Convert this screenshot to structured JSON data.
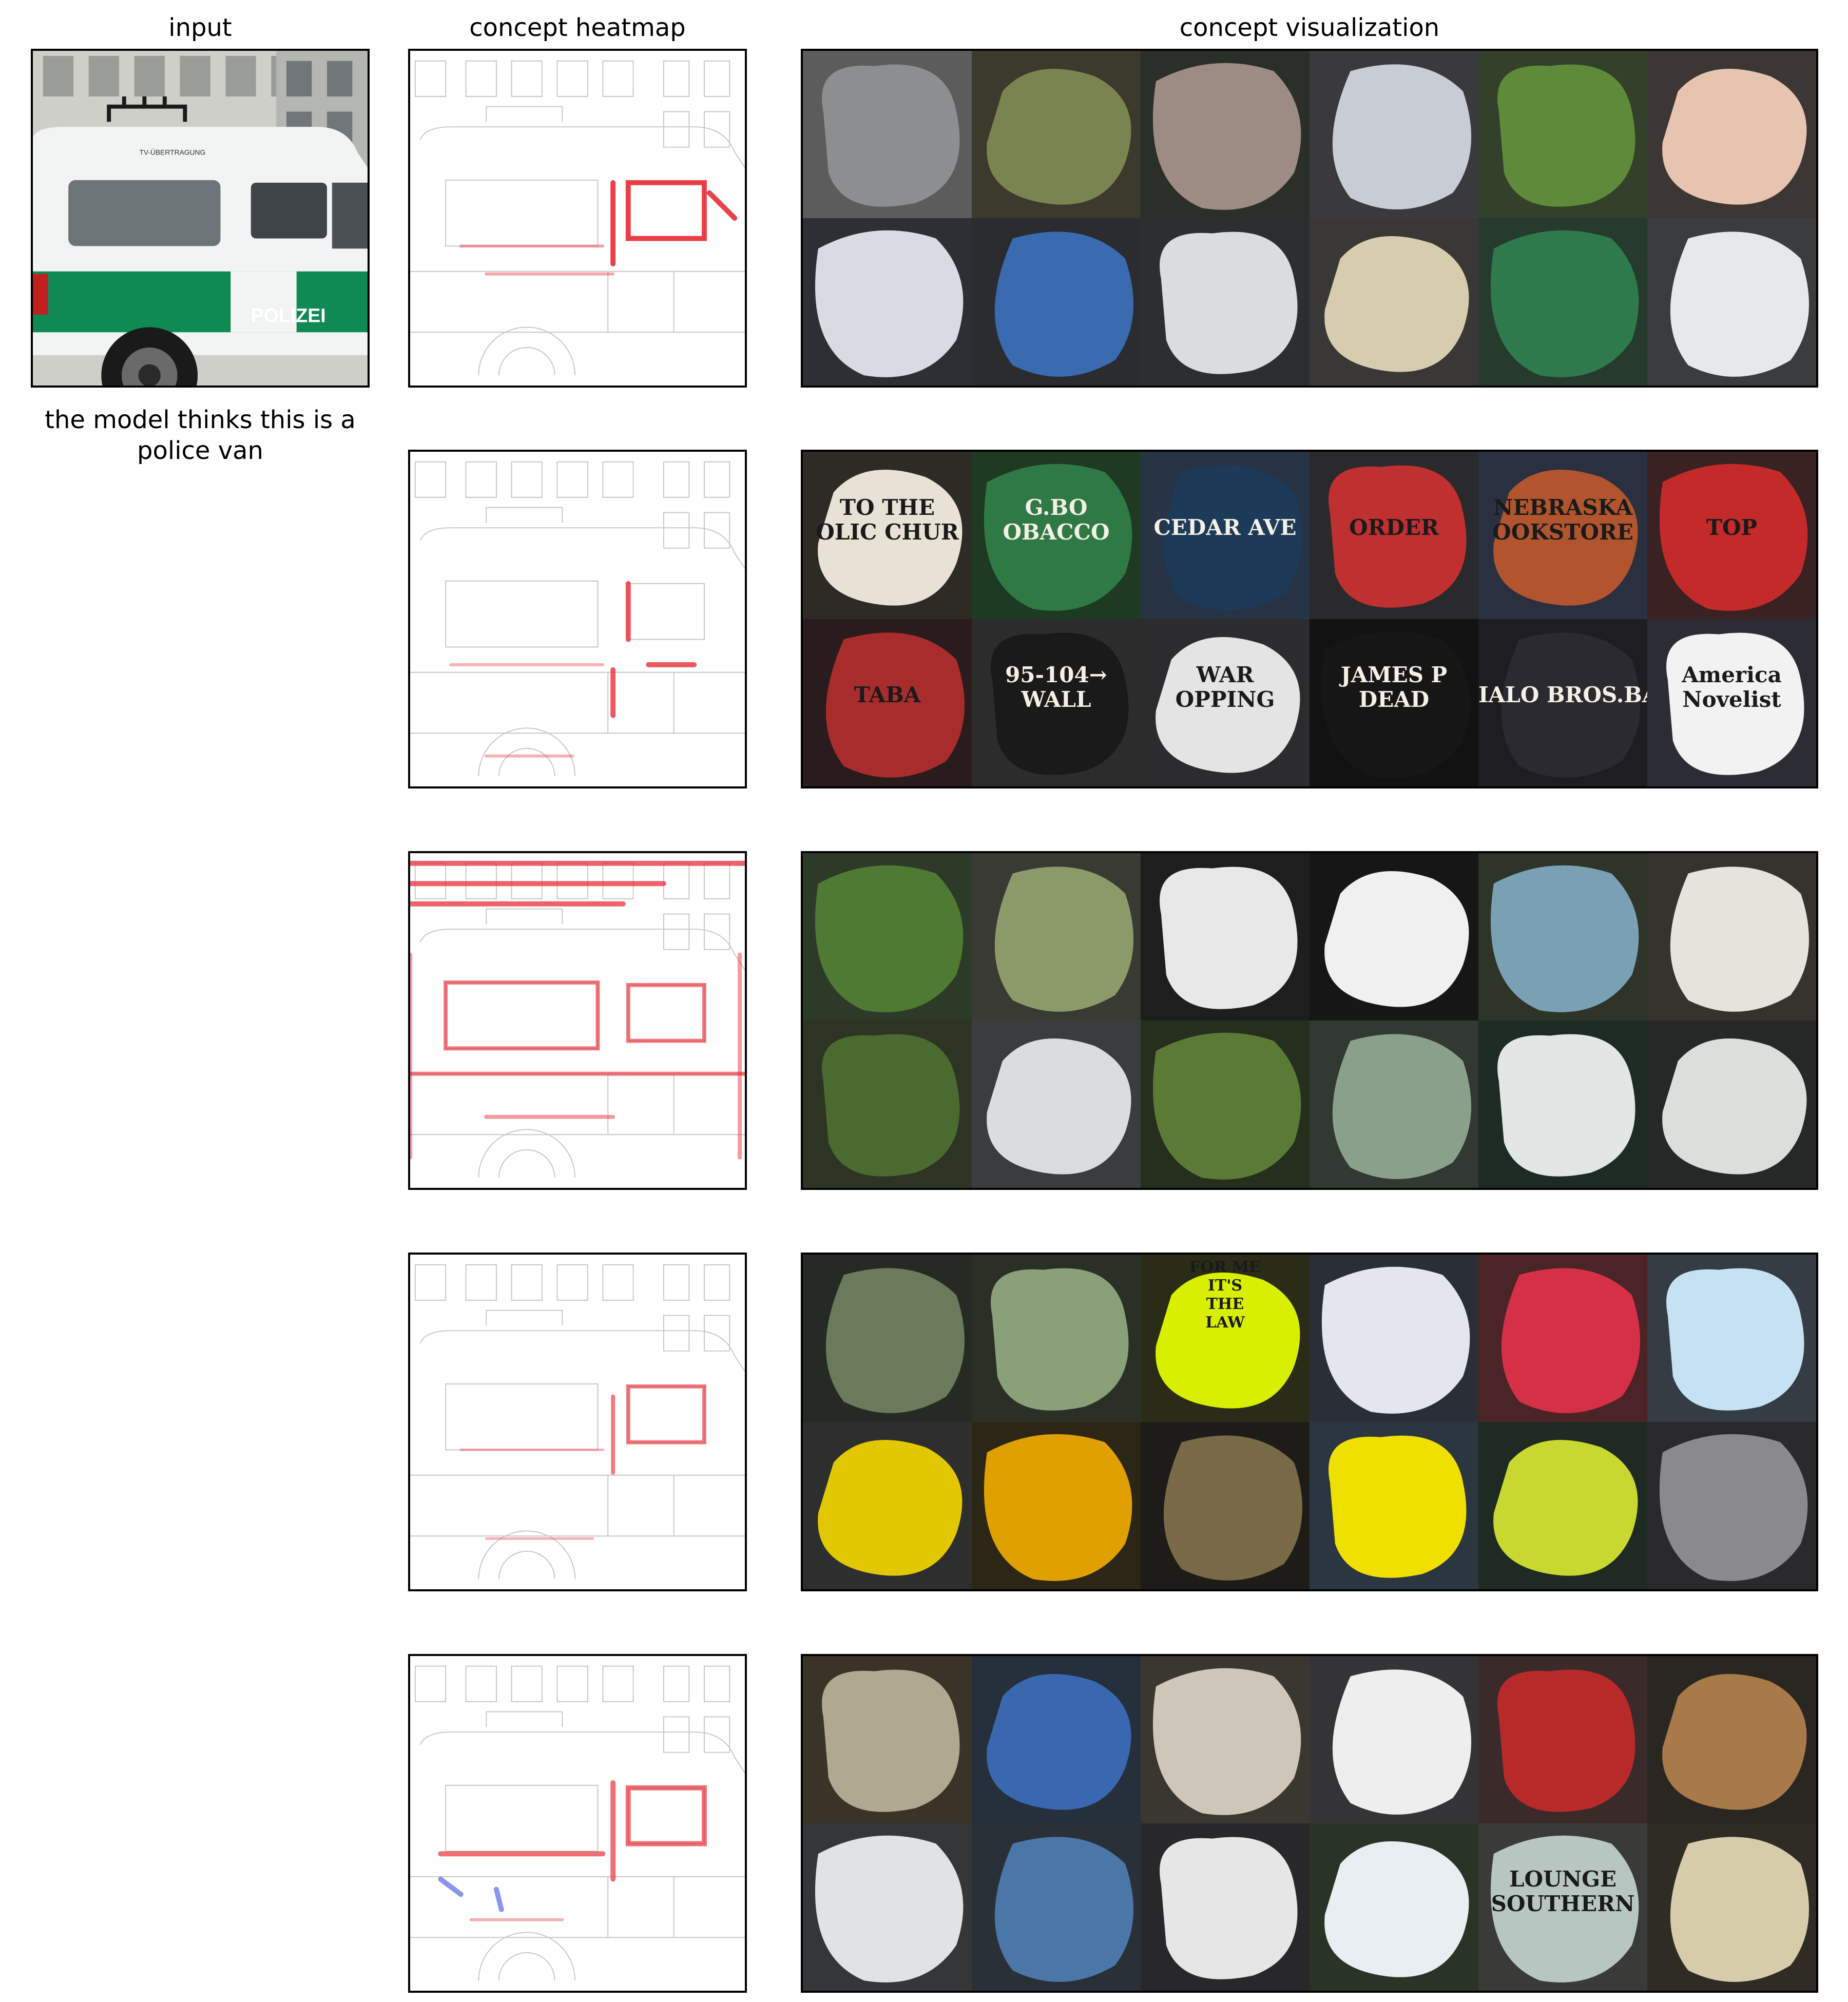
{
  "titles": {
    "input": "input",
    "heatmap": "concept heatmap",
    "visualization": "concept visualization"
  },
  "prediction": "the model thinks this is a police van",
  "input_image": {
    "description_icon": "police-van-photo",
    "van_text_top": "TV-ÜBERTRAGUNG",
    "van_text_side": "POLIZEI"
  },
  "colors": {
    "heat_red": "#e8202a",
    "heat_blue": "#3c50e0",
    "edge_gray": "#c8c8c8",
    "police_green": "#0f8a55",
    "van_white": "#f2f4f4"
  },
  "concepts": [
    {
      "tiles": [
        {
          "bg": "#5c5c5c",
          "blob": "#8c8e90",
          "label": ""
        },
        {
          "bg": "#3b3a2c",
          "blob": "#7a8450",
          "label": ""
        },
        {
          "bg": "#2b2f2a",
          "blob": "#9c8c84",
          "label": ""
        },
        {
          "bg": "#3a3a3c",
          "blob": "#c8ccd4",
          "label": ""
        },
        {
          "bg": "#33402a",
          "blob": "#5e8a3a",
          "label": ""
        },
        {
          "bg": "#3c3734",
          "blob": "#e6c4b0",
          "label": ""
        },
        {
          "bg": "#2c3034",
          "blob": "#d8dbe2",
          "label": ""
        },
        {
          "bg": "#2a2c30",
          "blob": "#3a6ab0",
          "label": ""
        },
        {
          "bg": "#2d2e30",
          "blob": "#dadde0",
          "label": ""
        },
        {
          "bg": "#3a3836",
          "blob": "#d6ccae",
          "label": ""
        },
        {
          "bg": "#263a2e",
          "blob": "#2e7a4c",
          "label": ""
        },
        {
          "bg": "#3a3c3e",
          "blob": "#e6e8ea",
          "label": ""
        }
      ]
    },
    {
      "tiles": [
        {
          "bg": "#2e2a26",
          "blob": "#e8e2d6",
          "label": "TO THE\nOLIC CHUR"
        },
        {
          "bg": "#1e3a22",
          "blob": "#2f7a44",
          "label": "G.BO\nOBACCO"
        },
        {
          "bg": "#263446",
          "blob": "#1d3a58",
          "label": "CEDAR AVE"
        },
        {
          "bg": "#2a2a2c",
          "blob": "#c03030",
          "label": "ORDER"
        },
        {
          "bg": "#2a3040",
          "blob": "#b2552e",
          "label": "NEBRASKA\nOOKSTORE"
        },
        {
          "bg": "#3a2222",
          "blob": "#c42a2a",
          "label": "TOP"
        },
        {
          "bg": "#2a1c1c",
          "blob": "#a82c2c",
          "label": "TABA"
        },
        {
          "bg": "#2c2c2c",
          "blob": "#1a1a1a",
          "label": "95-104→\nWALL"
        },
        {
          "bg": "#2c2c2e",
          "blob": "#e4e4e4",
          "label": "WAR\nOPPING"
        },
        {
          "bg": "#121212",
          "blob": "#161616",
          "label": "JAMES P\nDEAD"
        },
        {
          "bg": "#1e1e22",
          "blob": "#2a2a30",
          "label": "IALO BROS.BA"
        },
        {
          "bg": "#2c2c34",
          "blob": "#f2f2f2",
          "label": "America\nNovelist"
        }
      ]
    },
    {
      "tiles": [
        {
          "bg": "#2e3a28",
          "blob": "#4e7a34",
          "label": ""
        },
        {
          "bg": "#3a3a34",
          "blob": "#8c9a6a",
          "label": ""
        },
        {
          "bg": "#1e1e1e",
          "blob": "#e8e8e8",
          "label": ""
        },
        {
          "bg": "#161616",
          "blob": "#f0f0f0",
          "label": ""
        },
        {
          "bg": "#2e3428",
          "blob": "#7aa0b4",
          "label": ""
        },
        {
          "bg": "#36322e",
          "blob": "#e6e2dc",
          "label": ""
        },
        {
          "bg": "#2e3424",
          "blob": "#4a6a30",
          "label": ""
        },
        {
          "bg": "#3a3c3e",
          "blob": "#dadcde",
          "label": ""
        },
        {
          "bg": "#262e1e",
          "blob": "#5a7a36",
          "label": ""
        },
        {
          "bg": "#323832",
          "blob": "#8aa08a",
          "label": ""
        },
        {
          "bg": "#1e2a24",
          "blob": "#e2e6e4",
          "label": ""
        },
        {
          "bg": "#262828",
          "blob": "#dcdedc",
          "label": ""
        }
      ]
    },
    {
      "tiles": [
        {
          "bg": "#262a24",
          "blob": "#6a7a5a",
          "label": ""
        },
        {
          "bg": "#2a3026",
          "blob": "#8aa07a",
          "label": ""
        },
        {
          "bg": "#2a2c18",
          "blob": "#d8f000",
          "label": "FOR ME\nIT'S\nTHE\nLAW"
        },
        {
          "bg": "#2a2e36",
          "blob": "#e4e6ee",
          "label": ""
        },
        {
          "bg": "#4a2426",
          "blob": "#d63046",
          "label": ""
        },
        {
          "bg": "#363c44",
          "blob": "#c6e2f2",
          "label": ""
        },
        {
          "bg": "#2e2e2e",
          "blob": "#e2c800",
          "label": ""
        },
        {
          "bg": "#2c2616",
          "blob": "#e0a000",
          "label": ""
        },
        {
          "bg": "#1e1c18",
          "blob": "#786a46",
          "label": ""
        },
        {
          "bg": "#2c3640",
          "blob": "#f0e000",
          "label": ""
        },
        {
          "bg": "#1e2a22",
          "blob": "#c8d830",
          "label": ""
        },
        {
          "bg": "#2a2a2c",
          "blob": "#8a8a8e",
          "label": ""
        }
      ]
    },
    {
      "tiles": [
        {
          "bg": "#3a3428",
          "blob": "#b0a890",
          "label": ""
        },
        {
          "bg": "#26303c",
          "blob": "#3a68b0",
          "label": ""
        },
        {
          "bg": "#3a3630",
          "blob": "#cec6b8",
          "label": ""
        },
        {
          "bg": "#343436",
          "blob": "#eeeeee",
          "label": ""
        },
        {
          "bg": "#3a2a2a",
          "blob": "#b82a2a",
          "label": ""
        },
        {
          "bg": "#2a2622",
          "blob": "#a87a4a",
          "label": ""
        },
        {
          "bg": "#343638",
          "blob": "#e0e2e4",
          "label": ""
        },
        {
          "bg": "#2a3038",
          "blob": "#4a76a8",
          "label": ""
        },
        {
          "bg": "#28282a",
          "blob": "#e6e6e6",
          "label": ""
        },
        {
          "bg": "#2a3426",
          "blob": "#e8eef2",
          "label": ""
        },
        {
          "bg": "#3a3a38",
          "blob": "#b8c6c2",
          "label": "LOUNGE\nSOUTHERN"
        },
        {
          "bg": "#2e2c24",
          "blob": "#d6ccaa",
          "label": ""
        }
      ]
    }
  ]
}
